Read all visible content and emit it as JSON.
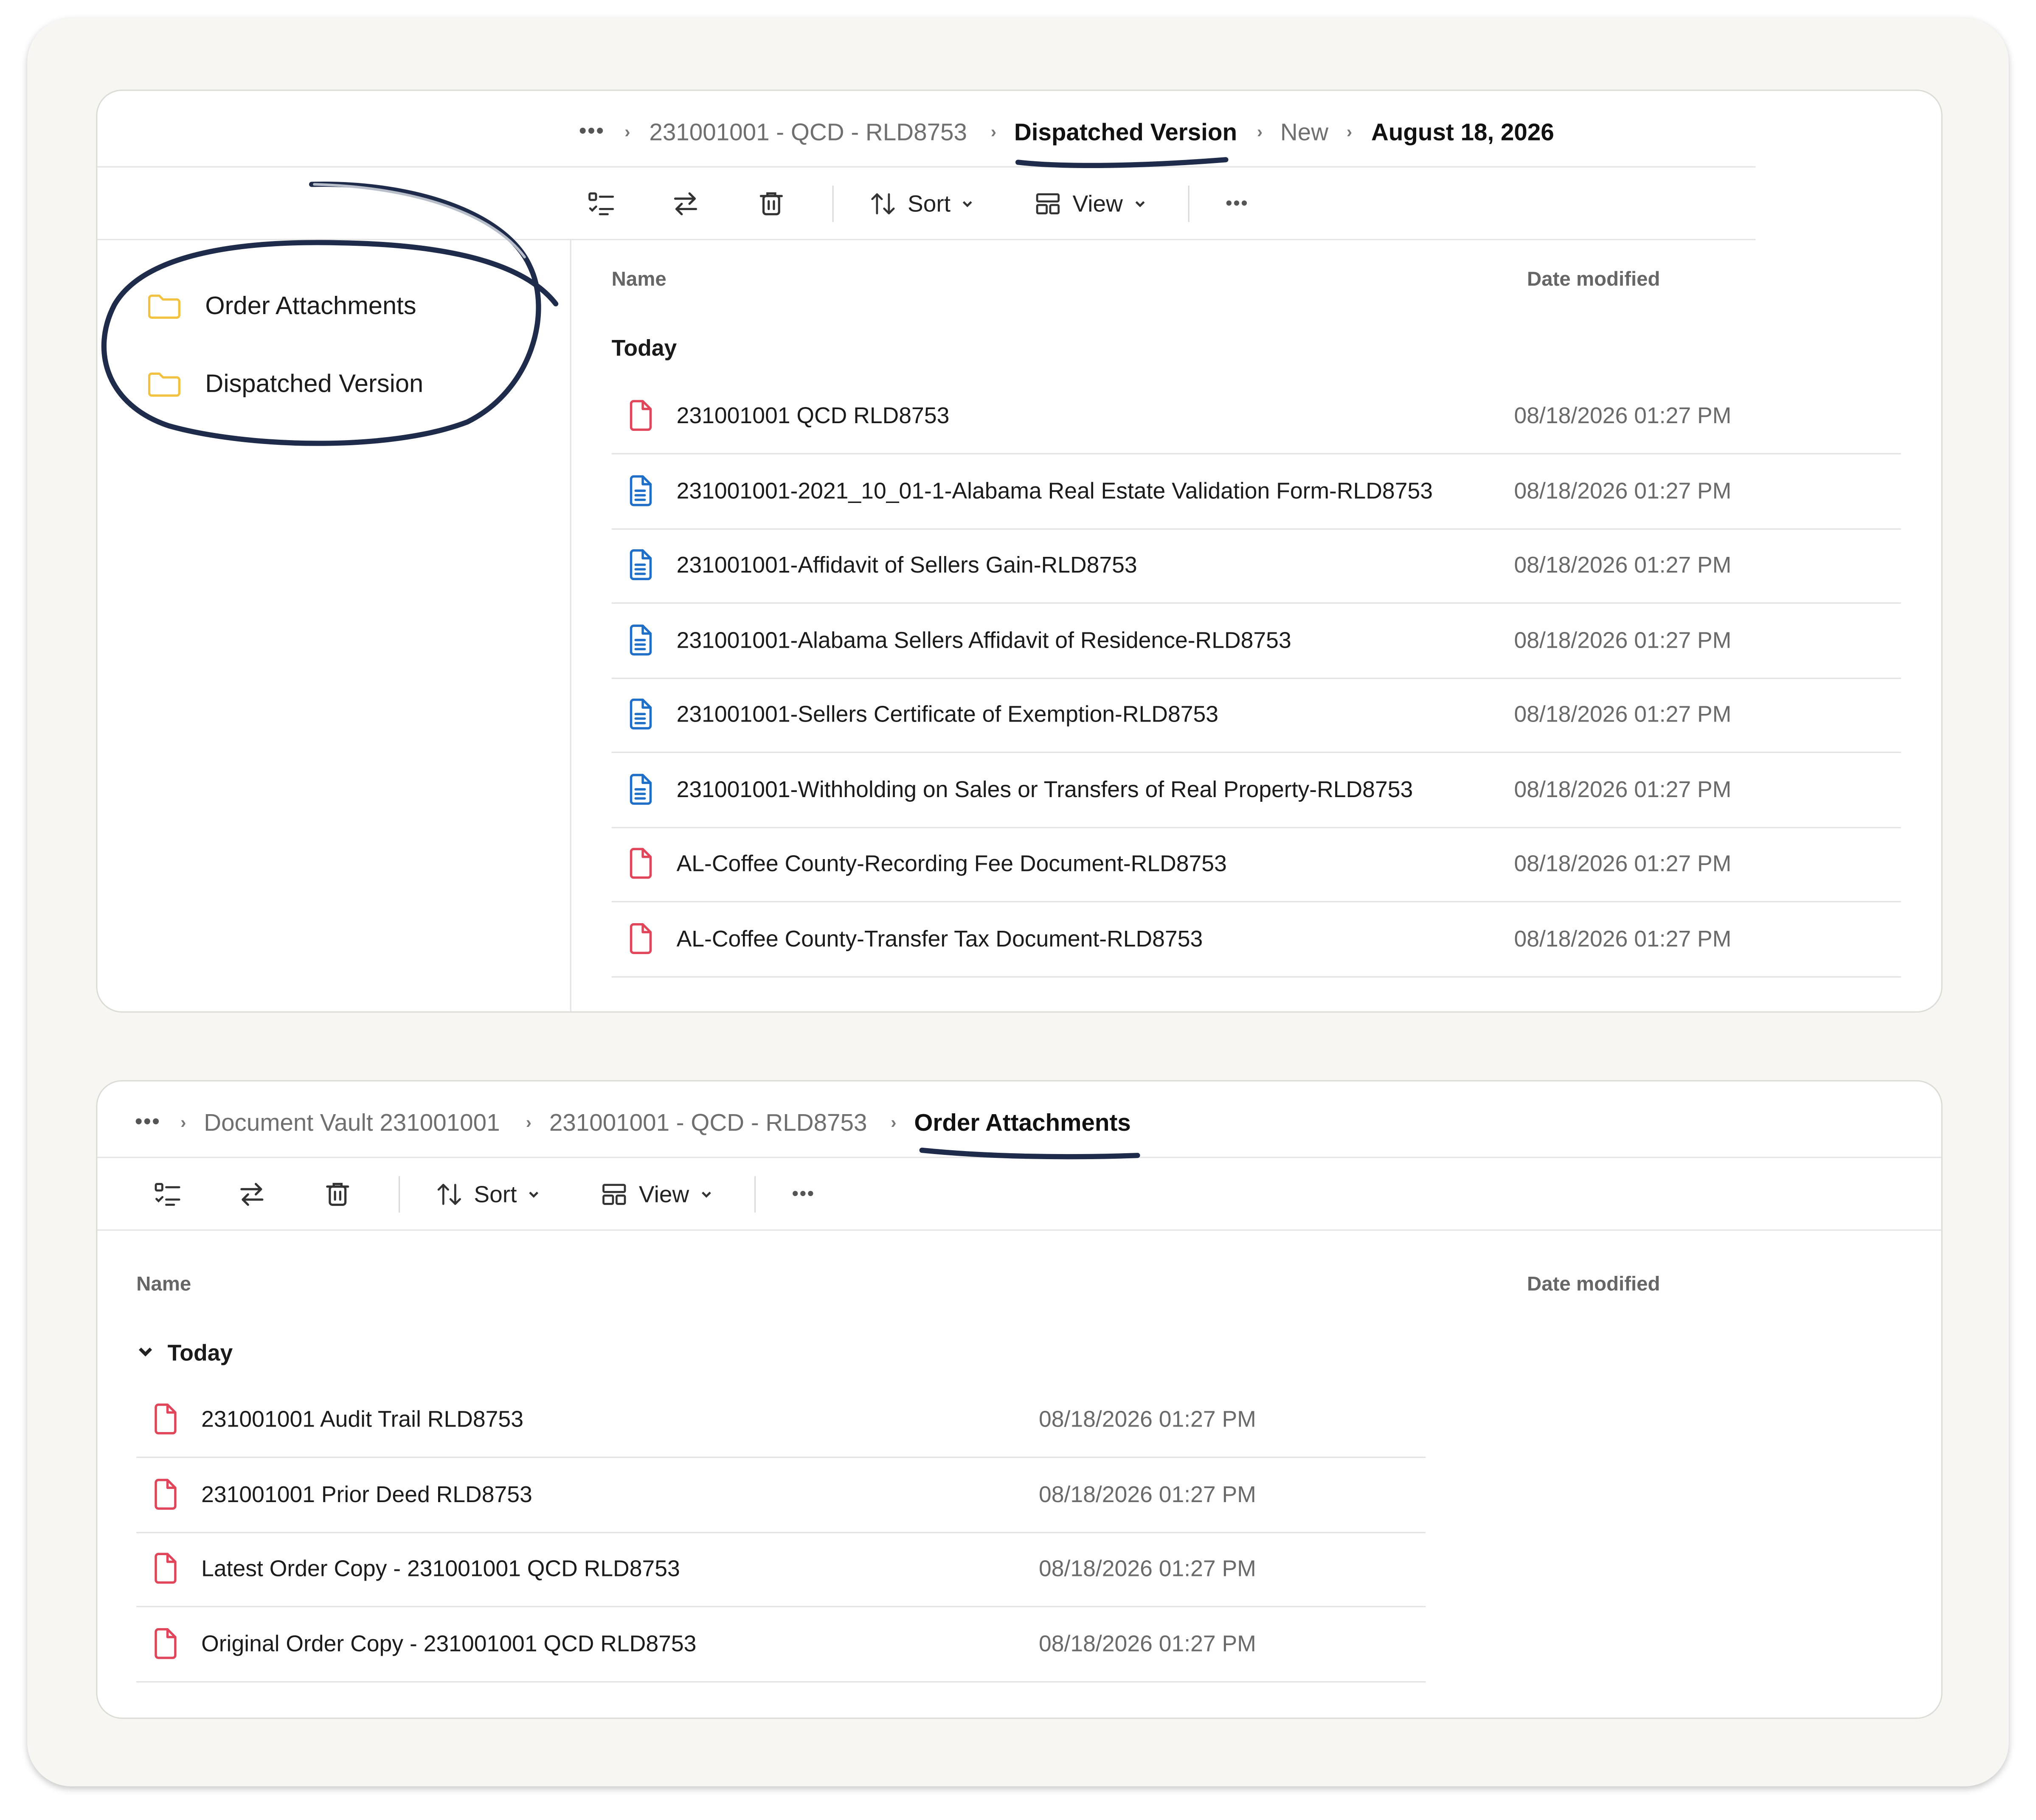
{
  "top_panel": {
    "breadcrumb": {
      "more": "•••",
      "items": [
        "231001001 - QCD - RLD8753",
        "Dispatched Version",
        "New",
        "August 18, 2026"
      ]
    },
    "toolbar": {
      "sort_label": "Sort",
      "view_label": "View",
      "more": "•••"
    },
    "sidebar": {
      "items": [
        {
          "label": "Order Attachments",
          "icon": "folder-icon"
        },
        {
          "label": "Dispatched Version",
          "icon": "folder-icon"
        }
      ]
    },
    "columns": {
      "name": "Name",
      "date": "Date modified"
    },
    "group": "Today",
    "files": [
      {
        "name": "231001001 QCD RLD8753",
        "date": "08/18/2026 01:27 PM",
        "type": "pdf"
      },
      {
        "name": "231001001-2021_10_01-1-Alabama Real Estate Validation Form-RLD8753",
        "date": "08/18/2026 01:27 PM",
        "type": "doc"
      },
      {
        "name": "231001001-Affidavit of Sellers Gain-RLD8753",
        "date": "08/18/2026 01:27 PM",
        "type": "doc"
      },
      {
        "name": "231001001-Alabama Sellers Affidavit of Residence-RLD8753",
        "date": "08/18/2026 01:27 PM",
        "type": "doc"
      },
      {
        "name": "231001001-Sellers Certificate of Exemption-RLD8753",
        "date": "08/18/2026 01:27 PM",
        "type": "doc"
      },
      {
        "name": "231001001-Withholding on Sales or Transfers of Real Property-RLD8753",
        "date": "08/18/2026 01:27 PM",
        "type": "doc"
      },
      {
        "name": "AL-Coffee County-Recording Fee Document-RLD8753",
        "date": "08/18/2026 01:27 PM",
        "type": "pdf"
      },
      {
        "name": "AL-Coffee County-Transfer Tax Document-RLD8753",
        "date": "08/18/2026 01:27 PM",
        "type": "pdf"
      }
    ]
  },
  "bottom_panel": {
    "breadcrumb": {
      "more": "•••",
      "items": [
        "Document Vault 231001001",
        "231001001 - QCD - RLD8753",
        "Order Attachments"
      ]
    },
    "toolbar": {
      "sort_label": "Sort",
      "view_label": "View",
      "more": "•••"
    },
    "columns": {
      "name": "Name",
      "date": "Date modified"
    },
    "group": "Today",
    "files": [
      {
        "name": "231001001 Audit Trail RLD8753",
        "date": "08/18/2026 01:27 PM",
        "type": "pdf"
      },
      {
        "name": "231001001 Prior Deed RLD8753",
        "date": "08/18/2026 01:27 PM",
        "type": "pdf"
      },
      {
        "name": "Latest Order Copy - 231001001 QCD RLD8753",
        "date": "08/18/2026 01:27 PM",
        "type": "pdf"
      },
      {
        "name": "Original Order Copy - 231001001 QCD RLD8753",
        "date": "08/18/2026 01:27 PM",
        "type": "pdf"
      }
    ]
  },
  "colors": {
    "pdf_icon": "#e0455a",
    "doc_icon": "#1f6fc9",
    "folder_icon": "#f2c13f",
    "annotation_ink": "#1e2b4a"
  }
}
